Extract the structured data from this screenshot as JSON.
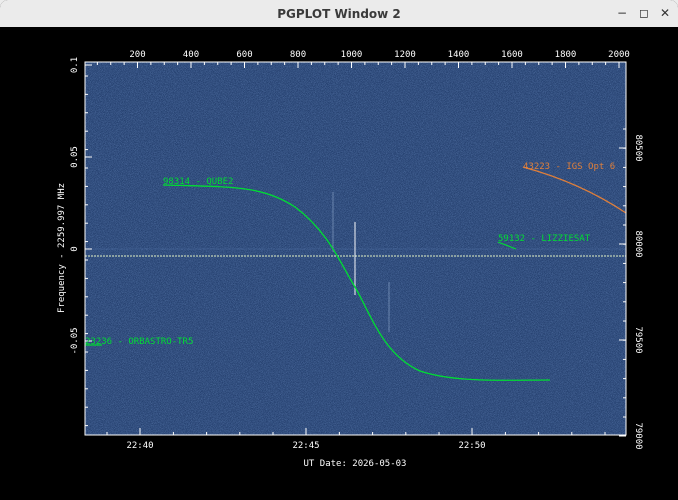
{
  "window": {
    "title": "PGPLOT Window 2"
  },
  "colors": {
    "plot_bg": "#2a4a7c",
    "frame": "#ffffff",
    "track_green": "#00dd33",
    "track_orange": "#e07f3a"
  },
  "chart_data": {
    "type": "line",
    "title": "",
    "xlabel": "UT Date: 2026-05-03",
    "ylabel_left": "Frequency - 2259.997 MHz",
    "x_bottom_ticks": [
      "22:40",
      "22:45",
      "22:50"
    ],
    "x_top_ticks": [
      "200",
      "400",
      "600",
      "800",
      "1000",
      "1200",
      "1400",
      "1600",
      "1800",
      "2000"
    ],
    "y_left_ticks": [
      "-0.05",
      "0",
      "0.05",
      "0.1"
    ],
    "y_right_ticks": [
      "79000",
      "79500",
      "80000",
      "80500"
    ],
    "y_left_range": [
      -0.1,
      0.1
    ],
    "satellites": [
      {
        "label": "98314 - QUBE2",
        "color": "green"
      },
      {
        "label": "43223 - IGS Opt 6",
        "color": "orange"
      },
      {
        "label": "59132 - LIZZIESAT",
        "color": "green"
      },
      {
        "label": "23236 - ORBASTRO-TR5",
        "color": "green"
      }
    ]
  }
}
